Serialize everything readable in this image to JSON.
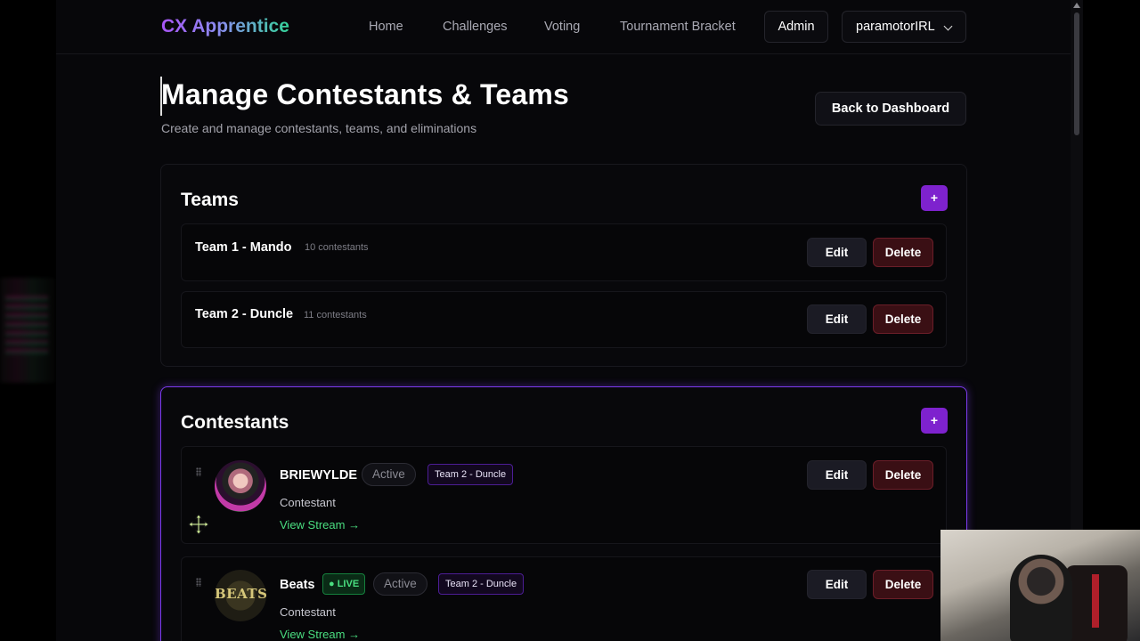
{
  "nav": {
    "brand": "CX Apprentice",
    "links": [
      "Home",
      "Challenges",
      "Voting",
      "Tournament Bracket"
    ],
    "admin_label": "Admin",
    "user_label": "paramotorIRL"
  },
  "header": {
    "title": "Manage Contestants & Teams",
    "subtitle": "Create and manage contestants, teams, and eliminations",
    "back_label": "Back to Dashboard"
  },
  "teams": {
    "title": "Teams",
    "add_label": "+",
    "items": [
      {
        "name": "Team 1 - Mando",
        "count": "10 contestants"
      },
      {
        "name": "Team 2 - Duncle",
        "count": "11 contestants"
      }
    ]
  },
  "contestants": {
    "title": "Contestants",
    "add_label": "+",
    "items": [
      {
        "name": "BRIEWYLDE",
        "live": "",
        "status": "Active",
        "team": "Team 2 - Duncle",
        "role": "Contestant",
        "link": "View Stream →",
        "avatar_text": ""
      },
      {
        "name": "Beats",
        "live": "● LIVE",
        "status": "Active",
        "team": "Team 2 - Duncle",
        "role": "Contestant",
        "link": "View Stream →",
        "avatar_text": "BEATS"
      }
    ]
  },
  "actions": {
    "edit_label": "Edit",
    "delete_label": "Delete"
  },
  "colors": {
    "accent": "#7e22ce",
    "live": "#4ade80",
    "delete_bg": "#3a0f14"
  },
  "icons": [
    "chevron-down-icon",
    "drag-handle-icon",
    "move-cursor-icon"
  ]
}
